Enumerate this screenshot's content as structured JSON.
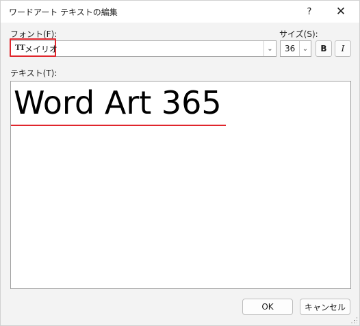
{
  "window": {
    "title": "ワードアート テキストの編集",
    "help_label": "?",
    "close_label": "✕"
  },
  "font": {
    "label": "フォント(F):",
    "value": "メイリオ",
    "icon": "truetype-icon",
    "icon_glyph": "TT"
  },
  "size": {
    "label": "サイズ(S):",
    "value": "36"
  },
  "style_buttons": {
    "bold": "B",
    "italic": "I"
  },
  "text": {
    "label": "テキスト(T):",
    "value": "Word Art 365"
  },
  "buttons": {
    "ok": "OK",
    "cancel": "キャンセル"
  },
  "colors": {
    "highlight": "#e0262c",
    "background": "#f3f3f3"
  }
}
